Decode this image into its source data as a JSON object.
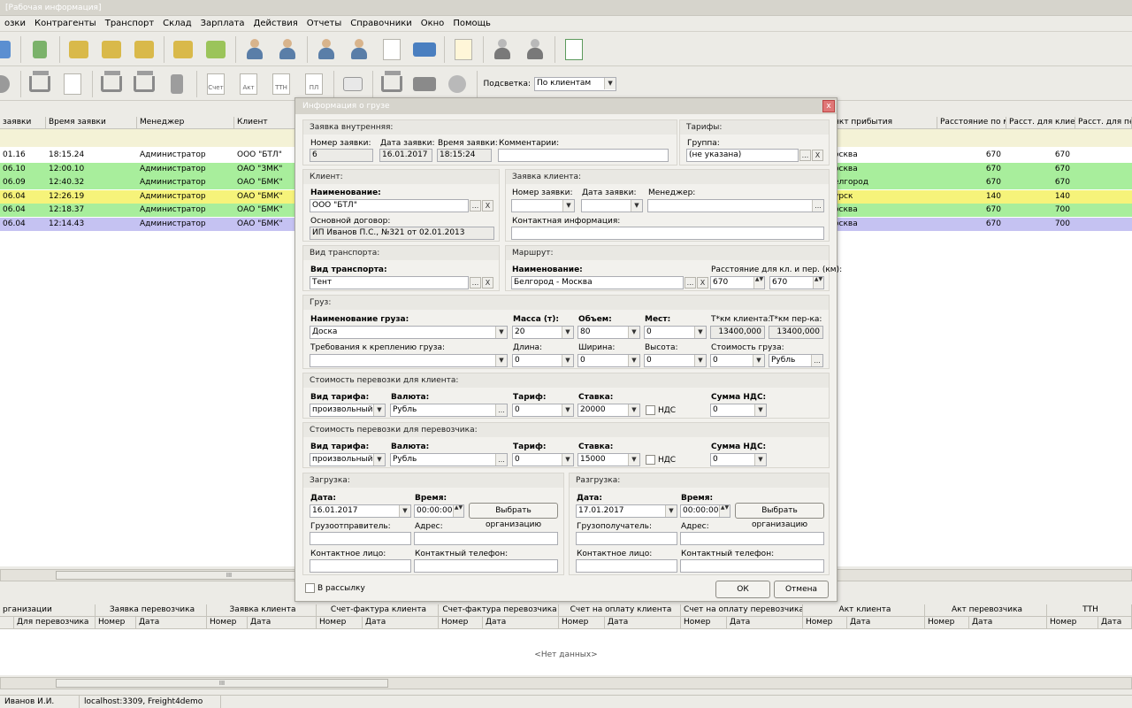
{
  "window_title": "[Рабочая информация]",
  "menu": [
    "озки",
    "Контрагенты",
    "Транспорт",
    "Склад",
    "Зарплата",
    "Действия",
    "Отчеты",
    "Справочники",
    "Окно",
    "Помощь"
  ],
  "toolbar2": {
    "doc_labels": [
      "Счет",
      "Акт",
      "ТТН",
      "ПЛ"
    ],
    "highlight_label": "Подсветка:",
    "highlight_value": "По клиентам"
  },
  "main_grid": {
    "left_headers": [
      "заявки",
      "Время заявки",
      "Менеджер",
      "Клиент"
    ],
    "right_headers": [
      "нкт прибытия",
      "Расстояние по ма",
      "Расст. для клиента",
      "Расст. для пере"
    ],
    "rows": [
      {
        "date": "01.16",
        "time": "18:15.24",
        "manager": "Администратор",
        "client": "ООО \"БТЛ\"",
        "dest": "осква",
        "d1": "670",
        "d2": "670",
        "color": "#ffffff"
      },
      {
        "date": "06.10",
        "time": "12:00.10",
        "manager": "Администратор",
        "client": "ОАО \"ЗМК\"",
        "dest": "осква",
        "d1": "670",
        "d2": "670",
        "color": "#a8ee9c"
      },
      {
        "date": "06.09",
        "time": "12:40.32",
        "manager": "Администратор",
        "client": "ОАО \"БМК\"",
        "dest": "елгород",
        "d1": "670",
        "d2": "670",
        "color": "#a8ee9c"
      },
      {
        "date": "06.04",
        "time": "12:26.19",
        "manager": "Администратор",
        "client": "ОАО \"БМК\"",
        "dest": "урск",
        "d1": "140",
        "d2": "140",
        "color": "#f6f37a"
      },
      {
        "date": "06.04",
        "time": "12:18.37",
        "manager": "Администратор",
        "client": "ОАО \"БМК\"",
        "dest": "осква",
        "d1": "670",
        "d2": "700",
        "color": "#a8ee9c"
      },
      {
        "date": "06.04",
        "time": "12:14.43",
        "manager": "Администратор",
        "client": "ОАО \"БМК\"",
        "dest": "осква",
        "d1": "670",
        "d2": "700",
        "color": "#c5c2f2"
      }
    ],
    "row_colors": {
      "white": "#ffffff",
      "green": "#a8ee9c",
      "yellow": "#f6f37a",
      "purple": "#c5c2f2"
    }
  },
  "bottom_grid": {
    "groups": [
      "рганизации",
      "Заявка перевозчика",
      "Заявка клиента",
      "Счет-фактура клиента",
      "Счет-фактура перевозчика",
      "Счет на оплату клиента",
      "Счет на оплату перевозчика",
      "Акт клиента",
      "Акт перевозчика",
      "ТТН"
    ],
    "sub": [
      "Для перевозчика",
      "Номер",
      "Дата",
      "Номер",
      "Дата",
      "Номер",
      "Дата",
      "Номер",
      "Дата",
      "Номер",
      "Дата",
      "Номер",
      "Дата",
      "Номер",
      "Дата",
      "Номер",
      "Дата",
      "Номер",
      "Дата"
    ],
    "empty_text": "<Нет данных>"
  },
  "scroll_grip": "III",
  "status": {
    "user": "Иванов И.И.",
    "server": "localhost:3309, Freight4demo"
  },
  "dialog": {
    "title": "Информация о грузе",
    "close": "x",
    "internal": {
      "title": "Заявка внутренняя:",
      "num_label": "Номер заявки:",
      "num": "6",
      "date_label": "Дата заявки:",
      "date": "16.01.2017",
      "time_label": "Время заявки:",
      "time": "18:15:24",
      "comment_label": "Комментарии:",
      "comment": ""
    },
    "tariffs": {
      "title": "Тарифы:",
      "group_label": "Группа:",
      "group": "(не указана)"
    },
    "client": {
      "title": "Клиент:",
      "name_label": "Наименование:",
      "name": "ООО \"БТЛ\"",
      "contract_label": "Основной договор:",
      "contract": "ИП Иванов П.С., №321 от 02.01.2013"
    },
    "client_request": {
      "title": "Заявка клиента:",
      "num_label": "Номер заявки:",
      "date_label": "Дата заявки:",
      "manager_label": "Менеджер:",
      "contact_label": "Контактная информация:"
    },
    "transport": {
      "title": "Вид транспорта:",
      "label": "Вид транспорта:",
      "value": "Тент"
    },
    "route": {
      "title": "Маршрут:",
      "name_label": "Наименование:",
      "name": "Белгород - Москва",
      "dist_label": "Расстояние для кл. и пер. (км):",
      "dist_client": "670",
      "dist_carrier": "670"
    },
    "cargo": {
      "title": "Груз:",
      "name_label": "Наименование груза:",
      "name": "Доска",
      "mass_label": "Масса (т):",
      "mass": "20",
      "volume_label": "Объем:",
      "volume": "80",
      "places_label": "Мест:",
      "places": "0",
      "tkm_client_label": "Т*км клиента:",
      "tkm_client": "13400,000",
      "tkm_carrier_label": "Т*км пер-ка:",
      "tkm_carrier": "13400,000",
      "fix_label": "Требования к креплению груза:",
      "length_label": "Длина:",
      "length": "0",
      "width_label": "Ширина:",
      "width": "0",
      "height_label": "Высота:",
      "height": "0",
      "cost_label": "Стоимость груза:",
      "cost": "0",
      "cost_currency": "Рубль"
    },
    "client_cost": {
      "title": "Стоимость перевозки для клиента:",
      "tariff_type_label": "Вид тарифа:",
      "tariff_type": "произвольный",
      "currency_label": "Валюта:",
      "currency": "Рубль",
      "tariff_label": "Тариф:",
      "tariff": "0",
      "rate_label": "Ставка:",
      "rate": "20000",
      "vat_label": "НДС",
      "vat_sum_label": "Сумма НДС:",
      "vat_sum": "0"
    },
    "carrier_cost": {
      "title": "Стоимость перевозки для перевозчика:",
      "tariff_type_label": "Вид тарифа:",
      "tariff_type": "произвольный",
      "currency_label": "Валюта:",
      "currency": "Рубль",
      "tariff_label": "Тариф:",
      "tariff": "0",
      "rate_label": "Ставка:",
      "rate": "15000",
      "vat_label": "НДС",
      "vat_sum_label": "Сумма НДС:",
      "vat_sum": "0"
    },
    "loading": {
      "title": "Загрузка:",
      "date_label": "Дата:",
      "date": "16.01.2017",
      "time_label": "Время:",
      "time": "00:00:00",
      "choose": "Выбрать организацию",
      "party_label": "Грузоотправитель:",
      "address_label": "Адрес:",
      "contact_label": "Контактное лицо:",
      "phone_label": "Контактный телефон:"
    },
    "unloading": {
      "title": "Разгрузка:",
      "date_label": "Дата:",
      "date": "17.01.2017",
      "time_label": "Время:",
      "time": "00:00:00",
      "choose": "Выбрать организацию",
      "party_label": "Грузополучатель:",
      "address_label": "Адрес:",
      "contact_label": "Контактное лицо:",
      "phone_label": "Контактный телефон:"
    },
    "mailing": "В рассылку",
    "ok": "ОК",
    "cancel": "Отмена",
    "btn_dots": "...",
    "btn_clear": "X",
    "dd_arrow": "▼",
    "spin_arrows": "▲▼"
  }
}
